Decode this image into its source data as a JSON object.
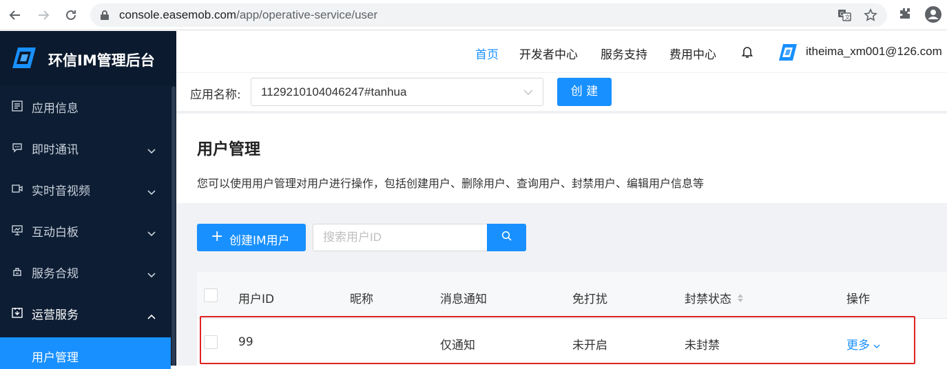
{
  "browser": {
    "url_host": "console.easemob.com",
    "url_path": "/app/operative-service/user"
  },
  "sidebar": {
    "brand_title": "环信IM管理后台",
    "items": [
      {
        "label": "应用信息",
        "icon": "app-info-icon",
        "has_chevron": false
      },
      {
        "label": "即时通讯",
        "icon": "chat-icon",
        "has_chevron": true
      },
      {
        "label": "实时音视频",
        "icon": "video-icon",
        "has_chevron": true
      },
      {
        "label": "互动白板",
        "icon": "whiteboard-icon",
        "has_chevron": true
      },
      {
        "label": "服务合规",
        "icon": "compliance-icon",
        "has_chevron": true
      },
      {
        "label": "运营服务",
        "icon": "operations-icon",
        "has_chevron": true,
        "expanded": true
      }
    ],
    "active_subitem": "用户管理"
  },
  "topnav": {
    "items": [
      "首页",
      "开发者中心",
      "服务支持",
      "费用中心"
    ],
    "active": "首页",
    "user_email": "itheima_xm001@126.com"
  },
  "appbar": {
    "label": "应用名称:",
    "selected_app": "1129210104046247#tanhua",
    "create_label": "创 建"
  },
  "page": {
    "title": "用户管理",
    "description": "您可以使用用户管理对用户进行操作，包括创建用户、删除用户、查询用户、封禁用户、编辑用户信息等"
  },
  "toolbar": {
    "add_label": "创建IM用户",
    "search_placeholder": "搜索用户ID"
  },
  "table": {
    "columns": [
      "用户ID",
      "昵称",
      "消息通知",
      "免打扰",
      "封禁状态",
      "操作"
    ],
    "rows": [
      {
        "user_id": "99",
        "nickname": "",
        "notify": "仅通知",
        "dnd": "未开启",
        "ban_status": "未封禁",
        "action": "更多"
      }
    ]
  },
  "colors": {
    "primary": "#1890ff",
    "sidebar_bg": "#0d1d33",
    "highlight_border": "#e02020"
  }
}
